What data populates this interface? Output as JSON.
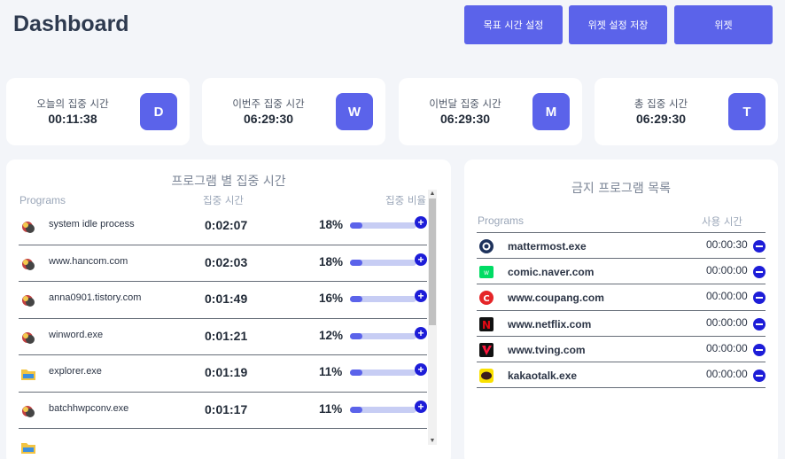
{
  "header": {
    "title": "Dashboard"
  },
  "toolbar": {
    "goal_time_label": "목표 시간 설정",
    "widget_save_label": "위젯 설정 저장",
    "widget_label": "위젯"
  },
  "stats": [
    {
      "label": "오늘의 집중 시간",
      "value": "00:11:38",
      "badge": "D"
    },
    {
      "label": "이번주 집중 시간",
      "value": "06:29:30",
      "badge": "W"
    },
    {
      "label": "이번달 집중 시간",
      "value": "06:29:30",
      "badge": "M"
    },
    {
      "label": "총 집중 시간",
      "value": "06:29:30",
      "badge": "T"
    }
  ],
  "programs_panel": {
    "title": "프로그램 별 집중 시간",
    "col_programs": "Programs",
    "col_time": "집중 시간",
    "col_ratio": "집중 비율",
    "rows": [
      {
        "name": "system idle process",
        "time": "0:02:07",
        "pct": "18%",
        "ratio": 0.18,
        "icon": "app-icon"
      },
      {
        "name": "www.hancom.com",
        "time": "0:02:03",
        "pct": "18%",
        "ratio": 0.18,
        "icon": "app-icon"
      },
      {
        "name": "anna0901.tistory.com",
        "time": "0:01:49",
        "pct": "16%",
        "ratio": 0.16,
        "icon": "app-icon"
      },
      {
        "name": "winword.exe",
        "time": "0:01:21",
        "pct": "12%",
        "ratio": 0.12,
        "icon": "app-icon"
      },
      {
        "name": "explorer.exe",
        "time": "0:01:19",
        "pct": "11%",
        "ratio": 0.11,
        "icon": "folder-icon"
      },
      {
        "name": "batchhwpconv.exe",
        "time": "0:01:17",
        "pct": "11%",
        "ratio": 0.11,
        "icon": "app-icon"
      }
    ]
  },
  "blocked_panel": {
    "title": "금지 프로그램 목록",
    "col_programs": "Programs",
    "col_time": "사용 시간",
    "rows": [
      {
        "name": "mattermost.exe",
        "time": "00:00:30",
        "icon": "mattermost-icon",
        "color": "#1e325c"
      },
      {
        "name": "comic.naver.com",
        "time": "00:00:00",
        "icon": "naver-webtoon-icon",
        "color": "#00dc64"
      },
      {
        "name": "www.coupang.com",
        "time": "00:00:00",
        "icon": "coupang-icon",
        "color": "#e52528"
      },
      {
        "name": "www.netflix.com",
        "time": "00:00:00",
        "icon": "netflix-icon",
        "color": "#111111"
      },
      {
        "name": "www.tving.com",
        "time": "00:00:00",
        "icon": "tving-icon",
        "color": "#ff153c"
      },
      {
        "name": "kakaotalk.exe",
        "time": "00:00:00",
        "icon": "kakaotalk-icon",
        "color": "#fae100"
      }
    ]
  },
  "colors": {
    "accent": "#5b63ea",
    "action_blue": "#1d1dd8"
  }
}
